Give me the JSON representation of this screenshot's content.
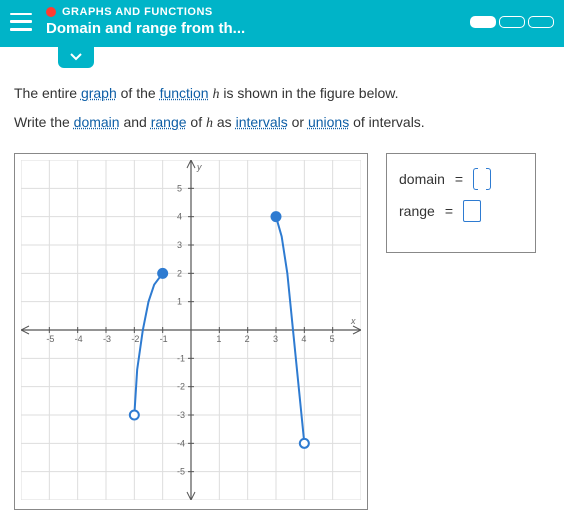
{
  "header": {
    "category": "GRAPHS AND FUNCTIONS",
    "title": "Domain and range from th..."
  },
  "prompt": {
    "line1_a": "The entire ",
    "graph_link": "graph",
    "line1_b": " of the ",
    "function_link": "function",
    "line1_c": " ",
    "fn_name": "h",
    "line1_d": " is shown in the figure below.",
    "line2_a": "Write the ",
    "domain_link": "domain",
    "line2_b": " and ",
    "range_link": "range",
    "line2_c": " of ",
    "line2_d": " as ",
    "intervals_link": "intervals",
    "line2_e": " or ",
    "unions_link": "unions",
    "line2_f": " of intervals."
  },
  "answer": {
    "domain_label": "domain",
    "range_label": "range",
    "equals": "="
  },
  "chart_data": {
    "type": "line",
    "title": "",
    "xlabel": "x",
    "ylabel": "y",
    "xlim": [
      -6,
      6
    ],
    "ylim": [
      -6,
      6
    ],
    "x_ticks": [
      -5,
      -4,
      -3,
      -2,
      -1,
      1,
      2,
      3,
      4,
      5
    ],
    "y_ticks": [
      -5,
      -4,
      -3,
      -2,
      -1,
      1,
      2,
      3,
      4,
      5
    ],
    "series": [
      {
        "name": "segment1",
        "endpoint_left": {
          "x": -2,
          "y": -3,
          "closed": false
        },
        "endpoint_right": {
          "x": -1,
          "y": 2,
          "closed": true
        },
        "points": [
          {
            "x": -2.0,
            "y": -3.0
          },
          {
            "x": -1.9,
            "y": -1.4
          },
          {
            "x": -1.7,
            "y": 0.0
          },
          {
            "x": -1.5,
            "y": 1.0
          },
          {
            "x": -1.3,
            "y": 1.6
          },
          {
            "x": -1.0,
            "y": 2.0
          }
        ]
      },
      {
        "name": "segment2",
        "endpoint_left": {
          "x": 3,
          "y": 4,
          "closed": true
        },
        "endpoint_right": {
          "x": 4,
          "y": -4,
          "closed": false
        },
        "points": [
          {
            "x": 3.0,
            "y": 4.0
          },
          {
            "x": 3.2,
            "y": 3.3
          },
          {
            "x": 3.4,
            "y": 2.0
          },
          {
            "x": 3.6,
            "y": 0.0
          },
          {
            "x": 3.8,
            "y": -2.0
          },
          {
            "x": 4.0,
            "y": -4.0
          }
        ]
      }
    ]
  }
}
